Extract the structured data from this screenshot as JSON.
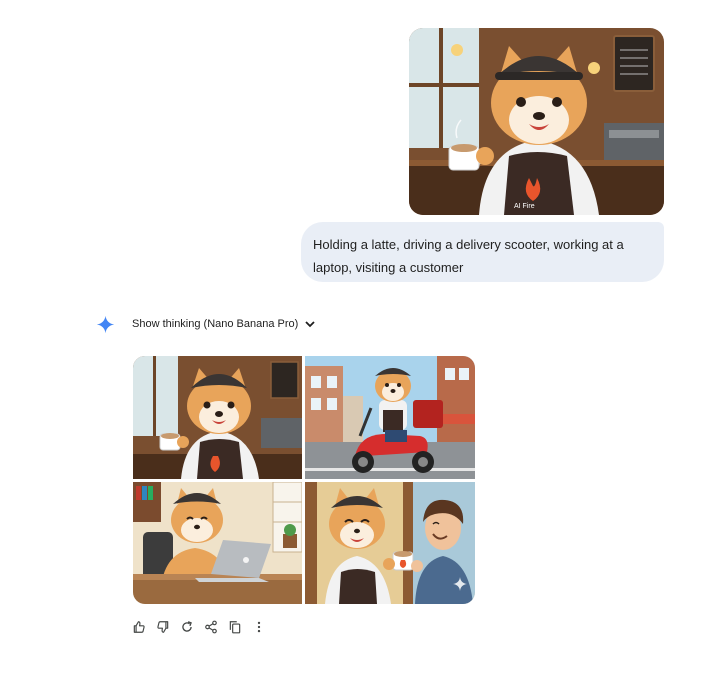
{
  "user_message": {
    "text": "Holding a latte, driving a delivery scooter, working at a laptop, visiting a customer"
  },
  "thinking": {
    "label": "Show thinking (Nano Banana Pro)"
  },
  "apron_logo_text": "AI Fire",
  "actions": [
    "thumbs-up-icon",
    "thumbs-down-icon",
    "regenerate-icon",
    "share-icon",
    "copy-icon",
    "more-options-icon"
  ],
  "colors": {
    "bubble_bg": "#e9eef6",
    "gemini_spark": "#4285f4",
    "shiba_fur": "#e8a45a",
    "apron": "#3b2a24"
  }
}
